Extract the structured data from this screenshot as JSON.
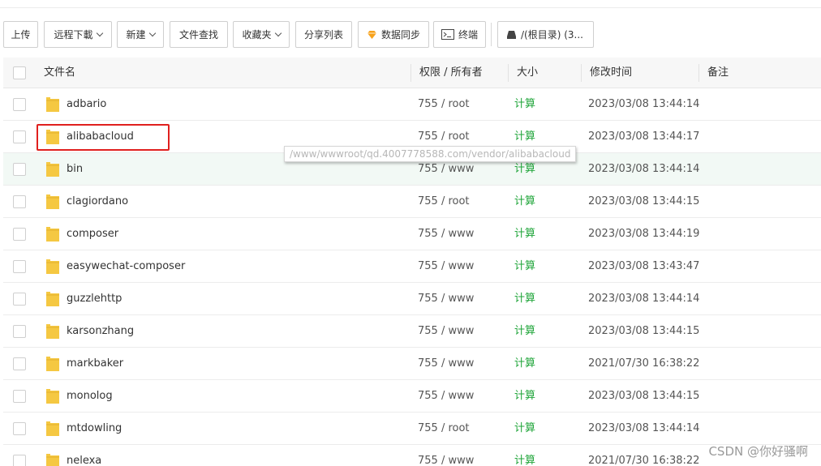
{
  "toolbar": {
    "upload": "上传",
    "remote_download": "远程下載",
    "new": "新建",
    "file_search": "文件查找",
    "favorites": "收藏夹",
    "share_list": "分享列表",
    "data_sync": "数据同步",
    "terminal": "终端",
    "path": "/(根目录) (3..."
  },
  "table": {
    "headers": {
      "name": "文件名",
      "permission": "权限 / 所有者",
      "size": "大小",
      "mtime": "修改时间",
      "note": "备注"
    },
    "rows": [
      {
        "name": "adbario",
        "perm": "755 / root",
        "size": "计算",
        "mtime": "2023/03/08 13:44:14"
      },
      {
        "name": "alibabacloud",
        "perm": "755 / root",
        "size": "计算",
        "mtime": "2023/03/08 13:44:17"
      },
      {
        "name": "bin",
        "perm": "755 / www",
        "size": "计算",
        "mtime": "2023/03/08 13:44:14"
      },
      {
        "name": "clagiordano",
        "perm": "755 / root",
        "size": "计算",
        "mtime": "2023/03/08 13:44:15"
      },
      {
        "name": "composer",
        "perm": "755 / www",
        "size": "计算",
        "mtime": "2023/03/08 13:44:19"
      },
      {
        "name": "easywechat-composer",
        "perm": "755 / www",
        "size": "计算",
        "mtime": "2023/03/08 13:43:47"
      },
      {
        "name": "guzzlehttp",
        "perm": "755 / www",
        "size": "计算",
        "mtime": "2023/03/08 13:44:14"
      },
      {
        "name": "karsonzhang",
        "perm": "755 / www",
        "size": "计算",
        "mtime": "2023/03/08 13:44:15"
      },
      {
        "name": "markbaker",
        "perm": "755 / www",
        "size": "计算",
        "mtime": "2021/07/30 16:38:22"
      },
      {
        "name": "monolog",
        "perm": "755 / www",
        "size": "计算",
        "mtime": "2023/03/08 13:44:15"
      },
      {
        "name": "mtdowling",
        "perm": "755 / root",
        "size": "计算",
        "mtime": "2023/03/08 13:44:14"
      },
      {
        "name": "nelexa",
        "perm": "755 / www",
        "size": "计算",
        "mtime": "2021/07/30 16:38:22"
      }
    ]
  },
  "tooltip": "/www/wwwroot/qd.4007778588.com/vendor/alibabacloud",
  "watermark": "CSDN @你好骚啊",
  "colors": {
    "size_link": "#20a53a",
    "folder": "#f5c842",
    "highlight_border": "#e0201e",
    "row_hover": "#f2f9f5",
    "sync_icon": "#f7a21b"
  },
  "icons": {
    "data_sync": "diamond-icon",
    "terminal": "terminal-icon",
    "path": "drive-icon",
    "row": "folder-icon"
  }
}
